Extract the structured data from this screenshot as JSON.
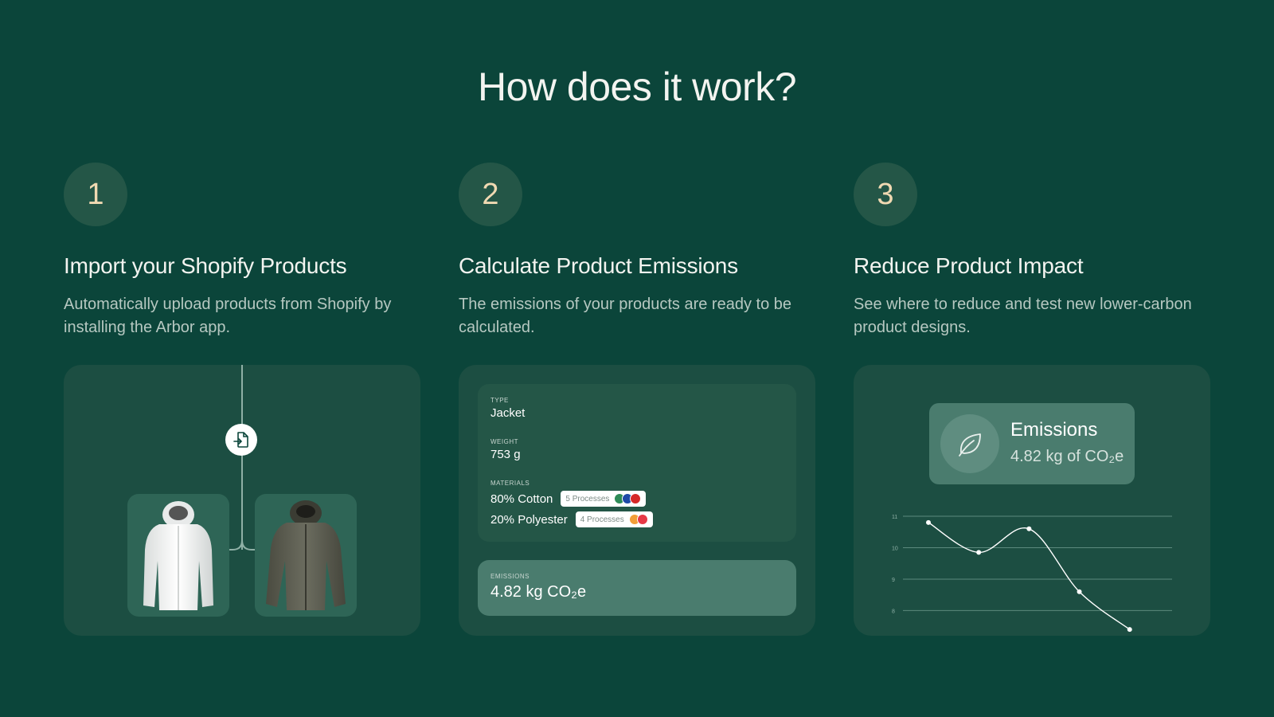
{
  "heading": "How does it work?",
  "steps": [
    {
      "number": "1",
      "title": "Import your Shopify Products",
      "description": "Automatically upload products from Shopify by installing the Arbor app."
    },
    {
      "number": "2",
      "title": "Calculate Product Emissions",
      "description": "The emissions of your products are ready to be calculated."
    },
    {
      "number": "3",
      "title": "Reduce Product Impact",
      "description": "See where to reduce and test new lower-carbon product designs."
    }
  ],
  "card1": {
    "icons": [
      "import-file-icon",
      "white-jacket-image",
      "olive-jacket-image"
    ]
  },
  "card2": {
    "type_label": "TYPE",
    "type_value": "Jacket",
    "weight_label": "WEIGHT",
    "weight_value": "753 g",
    "materials_label": "MATERIALS",
    "materials": [
      {
        "name": "80% Cotton",
        "processes": "5 Processes",
        "flags": [
          "#2e8b57",
          "#1f4aa8",
          "#d62828"
        ]
      },
      {
        "name": "20% Polyester",
        "processes": "4 Processes",
        "flags": [
          "#f29e38",
          "#e63946"
        ]
      }
    ],
    "emissions_label": "EMISSIONS",
    "emissions_number": "4.82",
    "emissions_unit": "kg CO₂e"
  },
  "card3": {
    "badge_title": "Emissions",
    "badge_value": "4.82 kg of CO₂e",
    "chart_data": {
      "type": "line",
      "y_ticks": [
        "11",
        "10",
        "9",
        "8"
      ],
      "ylim": [
        7.2,
        11
      ],
      "x": [
        1,
        2,
        3,
        4,
        5
      ],
      "values": [
        10.8,
        9.85,
        10.6,
        8.6,
        7.4
      ],
      "grid": true
    }
  },
  "colors": {
    "background": "#0b453a",
    "card": "#1c4e42",
    "accent": "#f0d9b2"
  }
}
